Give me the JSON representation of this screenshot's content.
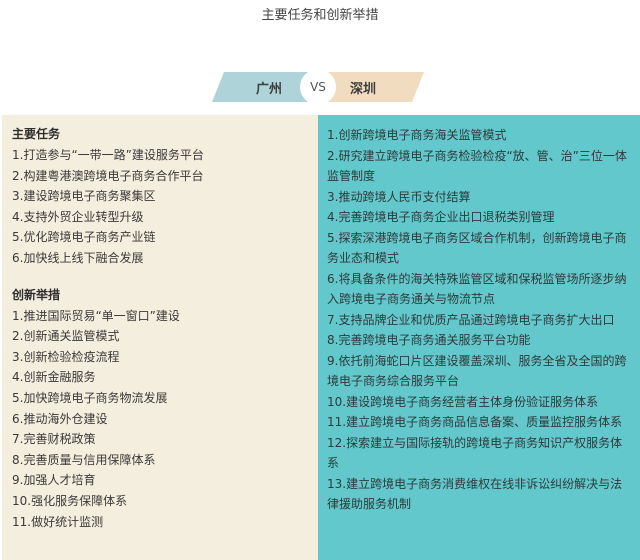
{
  "page_title": "主要任务和创新举措",
  "comparison": {
    "left_city": "广州",
    "vs_label": "VS",
    "right_city": "深圳"
  },
  "guangzhou": {
    "tasks_heading": "主要任务",
    "tasks": [
      "1.打造参与“一带一路”建设服务平台",
      "2.构建粤港澳跨境电子商务合作平台",
      "3.建设跨境电子商务聚集区",
      "4.支持外贸企业转型升级",
      "5.优化跨境电子商务产业链",
      "6.加快线上线下融合发展"
    ],
    "innovation_heading": "创新举措",
    "innovations": [
      "1.推进国际贸易“单一窗口”建设",
      "2.创新通关监管模式",
      "3.创新检验检疫流程",
      "4.创新金融服务",
      "5.加快跨境电子商务物流发展",
      "6.推动海外仓建设",
      "7.完善财税政策",
      "8.完善质量与信用保障体系",
      "9.加强人才培育",
      "10.强化服务保障体系",
      "11.做好统计监测"
    ]
  },
  "shenzhen": {
    "items": [
      "1.创新跨境电子商务海关监管模式",
      "2.研究建立跨境电子商务检验检疫“放、管、治”三位一体监管制度",
      "3.推动跨境人民币支付结算",
      "4.完善跨境电子商务企业出口退税类别管理",
      "5.探索深港跨境电子商务区域合作机制，创新跨境电子商务业态和模式",
      "6.将具备条件的海关特殊监管区域和保税监管场所逐步纳入跨境电子商务通关与物流节点",
      "7.支持品牌企业和优质产品通过跨境电子商务扩大出口",
      "8.完善跨境电子商务通关服务平台功能",
      "9.依托前海蛇口片区建设覆盖深圳、服务全省及全国的跨境电子商务综合服务平台",
      "10.建设跨境电子商务经营者主体身份验证服务体系",
      "11.建立跨境电子商务商品信息备案、质量监控服务体系",
      "12.探索建立与国际接轨的跨境电子商务知识产权服务体系",
      "13.建立跨境电子商务消费维权在线非诉讼纠纷解决与法律援助服务机制"
    ]
  },
  "colors": {
    "left_panel": "#f4eede",
    "right_panel": "#62c8cc",
    "vs_left_band": "#aed3d8",
    "vs_right_band": "#f2dcc0"
  }
}
